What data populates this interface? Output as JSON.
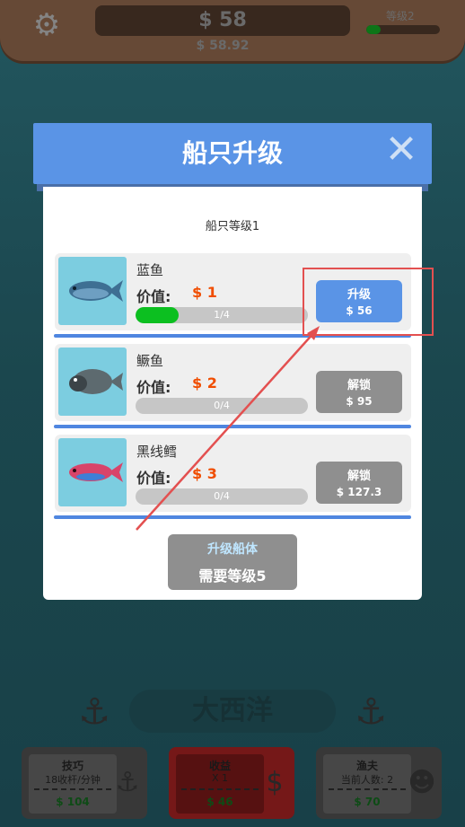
{
  "top": {
    "money": "$ 58",
    "money_rate": "$ 58.92",
    "level_label": "等级2",
    "level_progress": 0.2
  },
  "modal": {
    "title": "船只升级",
    "ship_level": "船只等级1",
    "fish": [
      {
        "name": "蓝鱼",
        "price_label": "价值:",
        "price": "$ 1",
        "progress_text": "1/4",
        "progress": 0.25,
        "button_label": "升级",
        "button_cost": "$ 56",
        "button_style": "blue"
      },
      {
        "name": "鳜鱼",
        "price_label": "价值:",
        "price": "$ 2",
        "progress_text": "0/4",
        "progress": 0,
        "button_label": "解锁",
        "button_cost": "$ 95",
        "button_style": "gray"
      },
      {
        "name": "黑线鳕",
        "price_label": "价值:",
        "price": "$ 3",
        "progress_text": "0/4",
        "progress": 0,
        "button_label": "解锁",
        "button_cost": "$ 127.3",
        "button_style": "gray"
      }
    ],
    "hull_button": {
      "title": "升级船体",
      "requirement": "需要等级5"
    }
  },
  "bottom": {
    "ocean_name": "大西洋",
    "cards": [
      {
        "title": "技巧",
        "sub": "18收杆/分钟",
        "value": "$ 104",
        "icon": "hook-icon"
      },
      {
        "title": "收益",
        "sub": "X 1",
        "value": "$ 46",
        "icon": "money-bag-icon"
      },
      {
        "title": "渔夫",
        "sub": "当前人数: 2",
        "value": "$ 70",
        "icon": "fisherman-icon"
      }
    ]
  },
  "colors": {
    "accent_blue": "#5a94e6",
    "price_orange": "#f04d00",
    "progress_green": "#0cbf20",
    "annotation_red": "#e35050"
  }
}
